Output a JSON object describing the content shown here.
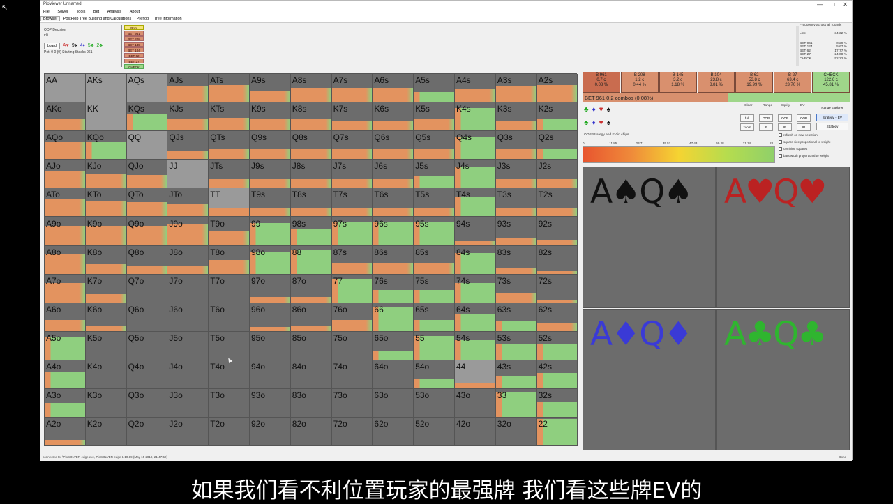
{
  "app": {
    "title": "PioViewer Unnamed",
    "win_controls": [
      "—",
      "□",
      "✕"
    ]
  },
  "menu": [
    "File",
    "Solver",
    "Tools",
    "Bet",
    "Analysis",
    "About"
  ],
  "tabs": [
    "Browser",
    "PostFlop Tree Building and Calculations",
    "Preflop",
    "Tree information"
  ],
  "top": {
    "node": "OOP Decision",
    "node_sub": "r:0",
    "board_btn": "board",
    "board_cards": [
      {
        "t": "A♥",
        "c": "#c33"
      },
      {
        "t": "9♠",
        "c": "#111"
      },
      {
        "t": "4♦",
        "c": "#33c"
      },
      {
        "t": "5♣",
        "c": "#2a2"
      },
      {
        "t": "2♣",
        "c": "#2a2"
      }
    ],
    "line_info": "Pot: 0 0 (0) Starting Stacks 961",
    "node_list": [
      "Root",
      "BET 961",
      "BET 208",
      "BET 145",
      "BET 104",
      "BET 62",
      "BET 27",
      "CHECK"
    ]
  },
  "freq_panel": {
    "title": "Frequency across all rounds",
    "rows": [
      {
        "k": "Line",
        "v": "34.32 %"
      },
      {
        "k": "BET 961",
        "v": "0.29 %"
      },
      {
        "k": "BET 124",
        "v": "5.67 %"
      },
      {
        "k": "BET 62",
        "v": "17.77 %"
      },
      {
        "k": "BET 27",
        "v": "24.08 %"
      },
      {
        "k": "CHECK",
        "v": "52.22 %"
      }
    ]
  },
  "grid": {
    "labels": [
      [
        "AA",
        "AKs",
        "AQs",
        "AJs",
        "ATs",
        "A9s",
        "A8s",
        "A7s",
        "A6s",
        "A5s",
        "A4s",
        "A3s",
        "A2s"
      ],
      [
        "AKo",
        "KK",
        "KQs",
        "KJs",
        "KTs",
        "K9s",
        "K8s",
        "K7s",
        "K6s",
        "K5s",
        "K4s",
        "K3s",
        "K2s"
      ],
      [
        "AQo",
        "KQo",
        "QQ",
        "QJs",
        "QTs",
        "Q9s",
        "Q8s",
        "Q7s",
        "Q6s",
        "Q5s",
        "Q4s",
        "Q3s",
        "Q2s"
      ],
      [
        "AJo",
        "KJo",
        "QJo",
        "JJ",
        "JTs",
        "J9s",
        "J8s",
        "J7s",
        "J6s",
        "J5s",
        "J4s",
        "J3s",
        "J2s"
      ],
      [
        "ATo",
        "KTo",
        "QTo",
        "JTo",
        "TT",
        "T9s",
        "T8s",
        "T7s",
        "T6s",
        "T5s",
        "T4s",
        "T3s",
        "T2s"
      ],
      [
        "A9o",
        "K9o",
        "Q9o",
        "J9o",
        "T9o",
        "99",
        "98s",
        "97s",
        "96s",
        "95s",
        "94s",
        "93s",
        "92s"
      ],
      [
        "A8o",
        "K8o",
        "Q8o",
        "J8o",
        "T8o",
        "98o",
        "88",
        "87s",
        "86s",
        "85s",
        "84s",
        "83s",
        "82s"
      ],
      [
        "A7o",
        "K7o",
        "Q7o",
        "J7o",
        "T7o",
        "97o",
        "87o",
        "77",
        "76s",
        "75s",
        "74s",
        "73s",
        "72s"
      ],
      [
        "A6o",
        "K6o",
        "Q6o",
        "J6o",
        "T6o",
        "96o",
        "86o",
        "76o",
        "66",
        "65s",
        "64s",
        "63s",
        "62s"
      ],
      [
        "A5o",
        "K5o",
        "Q5o",
        "J5o",
        "T5o",
        "95o",
        "85o",
        "75o",
        "65o",
        "55",
        "54s",
        "53s",
        "52s"
      ],
      [
        "A4o",
        "K4o",
        "Q4o",
        "J4o",
        "T4o",
        "94o",
        "84o",
        "74o",
        "64o",
        "54o",
        "44",
        "43s",
        "42s"
      ],
      [
        "A3o",
        "K3o",
        "Q3o",
        "J3o",
        "T3o",
        "93o",
        "83o",
        "73o",
        "63o",
        "53o",
        "43o",
        "33",
        "32s"
      ],
      [
        "A2o",
        "K2o",
        "Q2o",
        "J2o",
        "T2o",
        "92o",
        "82o",
        "72o",
        "62o",
        "52o",
        "42o",
        "32o",
        "22"
      ]
    ],
    "fills": [
      [
        0,
        0,
        0,
        0.55,
        0.6,
        0.4,
        0.5,
        0.5,
        0.5,
        0.35,
        0.45,
        0.55,
        0.6
      ],
      [
        0.4,
        0,
        0.6,
        0.4,
        0.45,
        0.4,
        0.4,
        0.35,
        0.35,
        0.4,
        0.8,
        0.35,
        0.4
      ],
      [
        0.6,
        0.6,
        0,
        0.3,
        0.35,
        0.35,
        0.35,
        0.35,
        0.35,
        0.35,
        0.8,
        0.35,
        0.35
      ],
      [
        0.6,
        0.5,
        0.45,
        0,
        0.3,
        0.3,
        0.3,
        0.3,
        0.3,
        0.4,
        0.75,
        0.3,
        0.3
      ],
      [
        0.6,
        0.55,
        0.5,
        0.45,
        0.3,
        0.3,
        0.3,
        0.3,
        0.3,
        0.3,
        0.7,
        0.3,
        0.3
      ],
      [
        0.7,
        0.7,
        0.7,
        0.75,
        0.5,
        0.8,
        0.6,
        0.85,
        0.85,
        0.85,
        0.15,
        0.25,
        0.2
      ],
      [
        0.7,
        0.35,
        0.3,
        0.3,
        0.5,
        0.8,
        0.85,
        0.4,
        0.4,
        0.4,
        0.75,
        0.2,
        0.1
      ],
      [
        0.7,
        0.3,
        0,
        0,
        0,
        0.2,
        0.2,
        0.85,
        0.45,
        0.45,
        0.7,
        0.35,
        0.1
      ],
      [
        0.4,
        0.2,
        0,
        0,
        0,
        0.15,
        0.2,
        0.4,
        0.85,
        0.4,
        0.6,
        0.35,
        0.3
      ],
      [
        0.8,
        0,
        0,
        0,
        0,
        0,
        0,
        0,
        0.3,
        0.85,
        0.7,
        0.55,
        0.55
      ],
      [
        0.6,
        0,
        0,
        0,
        0,
        0,
        0,
        0,
        0,
        0.35,
        0.2,
        0.45,
        0.55
      ],
      [
        0.5,
        0,
        0,
        0,
        0,
        0,
        0,
        0,
        0,
        0,
        0,
        0.9,
        0.55
      ],
      [
        0.2,
        0,
        0,
        0,
        0,
        0,
        0,
        0,
        0,
        0,
        0,
        0,
        0.95
      ]
    ],
    "types": [
      [
        "x",
        "x",
        "x",
        "o",
        "o",
        "o",
        "o",
        "o",
        "o",
        "g",
        "o",
        "o",
        "o"
      ],
      [
        "o",
        "x",
        "g",
        "o",
        "o",
        "o",
        "o",
        "o",
        "o",
        "o",
        "g",
        "o",
        "g"
      ],
      [
        "o",
        "g",
        "x",
        "o",
        "o",
        "o",
        "o",
        "o",
        "o",
        "o",
        "g",
        "o",
        "g"
      ],
      [
        "o",
        "o",
        "o",
        "x",
        "o",
        "o",
        "o",
        "o",
        "o",
        "g",
        "g",
        "o",
        "o"
      ],
      [
        "o",
        "o",
        "o",
        "o",
        "x",
        "o",
        "o",
        "o",
        "o",
        "o",
        "g",
        "o",
        "o"
      ],
      [
        "o",
        "o",
        "o",
        "o",
        "o",
        "g",
        "g",
        "g",
        "g",
        "g",
        "o",
        "o",
        "o"
      ],
      [
        "o",
        "o",
        "o",
        "o",
        "o",
        "g",
        "g",
        "o",
        "o",
        "o",
        "g",
        "o",
        "o"
      ],
      [
        "o",
        "o",
        "o",
        "o",
        "o",
        "o",
        "o",
        "g",
        "g",
        "g",
        "g",
        "o",
        "o"
      ],
      [
        "o",
        "o",
        "o",
        "o",
        "o",
        "o",
        "o",
        "o",
        "g",
        "g",
        "g",
        "g",
        "o"
      ],
      [
        "g",
        "o",
        "o",
        "o",
        "o",
        "o",
        "o",
        "o",
        "g",
        "g",
        "g",
        "g",
        "g"
      ],
      [
        "g",
        "o",
        "o",
        "o",
        "o",
        "o",
        "o",
        "o",
        "o",
        "g",
        "x",
        "g",
        "g"
      ],
      [
        "g",
        "o",
        "o",
        "o",
        "o",
        "o",
        "o",
        "o",
        "o",
        "o",
        "o",
        "g",
        "g"
      ],
      [
        "o",
        "o",
        "o",
        "o",
        "o",
        "o",
        "o",
        "o",
        "o",
        "o",
        "o",
        "o",
        "g"
      ]
    ]
  },
  "actions": [
    {
      "name": "B 961",
      "v1": "0.7 c",
      "v2": "0.08 %",
      "color": "#c96c4f"
    },
    {
      "name": "B 208",
      "v1": "1.2 c",
      "v2": "0.44 %",
      "color": "#d9906e"
    },
    {
      "name": "B 145",
      "v1": "3.2 c",
      "v2": "1.18 %",
      "color": "#d9906e"
    },
    {
      "name": "B 104",
      "v1": "23.8 c",
      "v2": "8.81 %",
      "color": "#d9906e"
    },
    {
      "name": "B 62",
      "v1": "53.8 c",
      "v2": "19.99 %",
      "color": "#d9906e"
    },
    {
      "name": "B 27",
      "v1": "63.4 c",
      "v2": "23.70 %",
      "color": "#d9906e"
    },
    {
      "name": "CHECK",
      "v1": "122.6 c",
      "v2": "45.81 %",
      "color": "#9fd68a"
    }
  ],
  "bet_bar": "BET 961   0.2 combos (0.08%)",
  "suit_rows": [
    [
      {
        "t": "♣",
        "c": "#2a2"
      },
      {
        "t": "♦",
        "c": "#33c"
      },
      {
        "t": "♥",
        "c": "#c33"
      },
      {
        "t": "♠",
        "c": "#111"
      }
    ],
    [
      {
        "t": "♣",
        "c": "#2a2"
      },
      {
        "t": "♦",
        "c": "#33c"
      },
      {
        "t": "♥",
        "c": "#c33"
      },
      {
        "t": "♠",
        "c": "#111"
      }
    ]
  ],
  "controls": {
    "labels": [
      "Clear",
      "Range",
      "Equity",
      "EV"
    ],
    "row1": [
      "full",
      "OOP",
      "OOP",
      "OOP"
    ],
    "row2": [
      "zoom",
      "IP",
      "IP",
      "IP"
    ],
    "side": [
      "Range Explorer",
      "Strategy + EV",
      "Strategy"
    ]
  },
  "scale": {
    "title": "OOP Strategy and EV in chips",
    "ticks": [
      "0",
      "11.85",
      "23.71",
      "35.57",
      "47.43",
      "59.28",
      "71.14",
      "83"
    ]
  },
  "options": [
    "refresh on new selection",
    "square size proportional to weight",
    "combine squares",
    "bars width proportional to weight"
  ],
  "combos": [
    {
      "text": "A♠Q♠",
      "color": "#111"
    },
    {
      "text": "A♥Q♥",
      "color": "#b22"
    },
    {
      "text": "A♦Q♦",
      "color": "#3a3ad6"
    },
    {
      "text": "A♣Q♣",
      "color": "#2fb52f"
    }
  ],
  "status": {
    "left": "connected to: \\PioSOLVER-edge.exe, PioSOLVER-edge 1.10.19 (May 15 2019, 21:47:52)",
    "right": "Done"
  },
  "subtitle": "如果我们看不利位置玩家的最强牌 我们看这些牌EV的"
}
